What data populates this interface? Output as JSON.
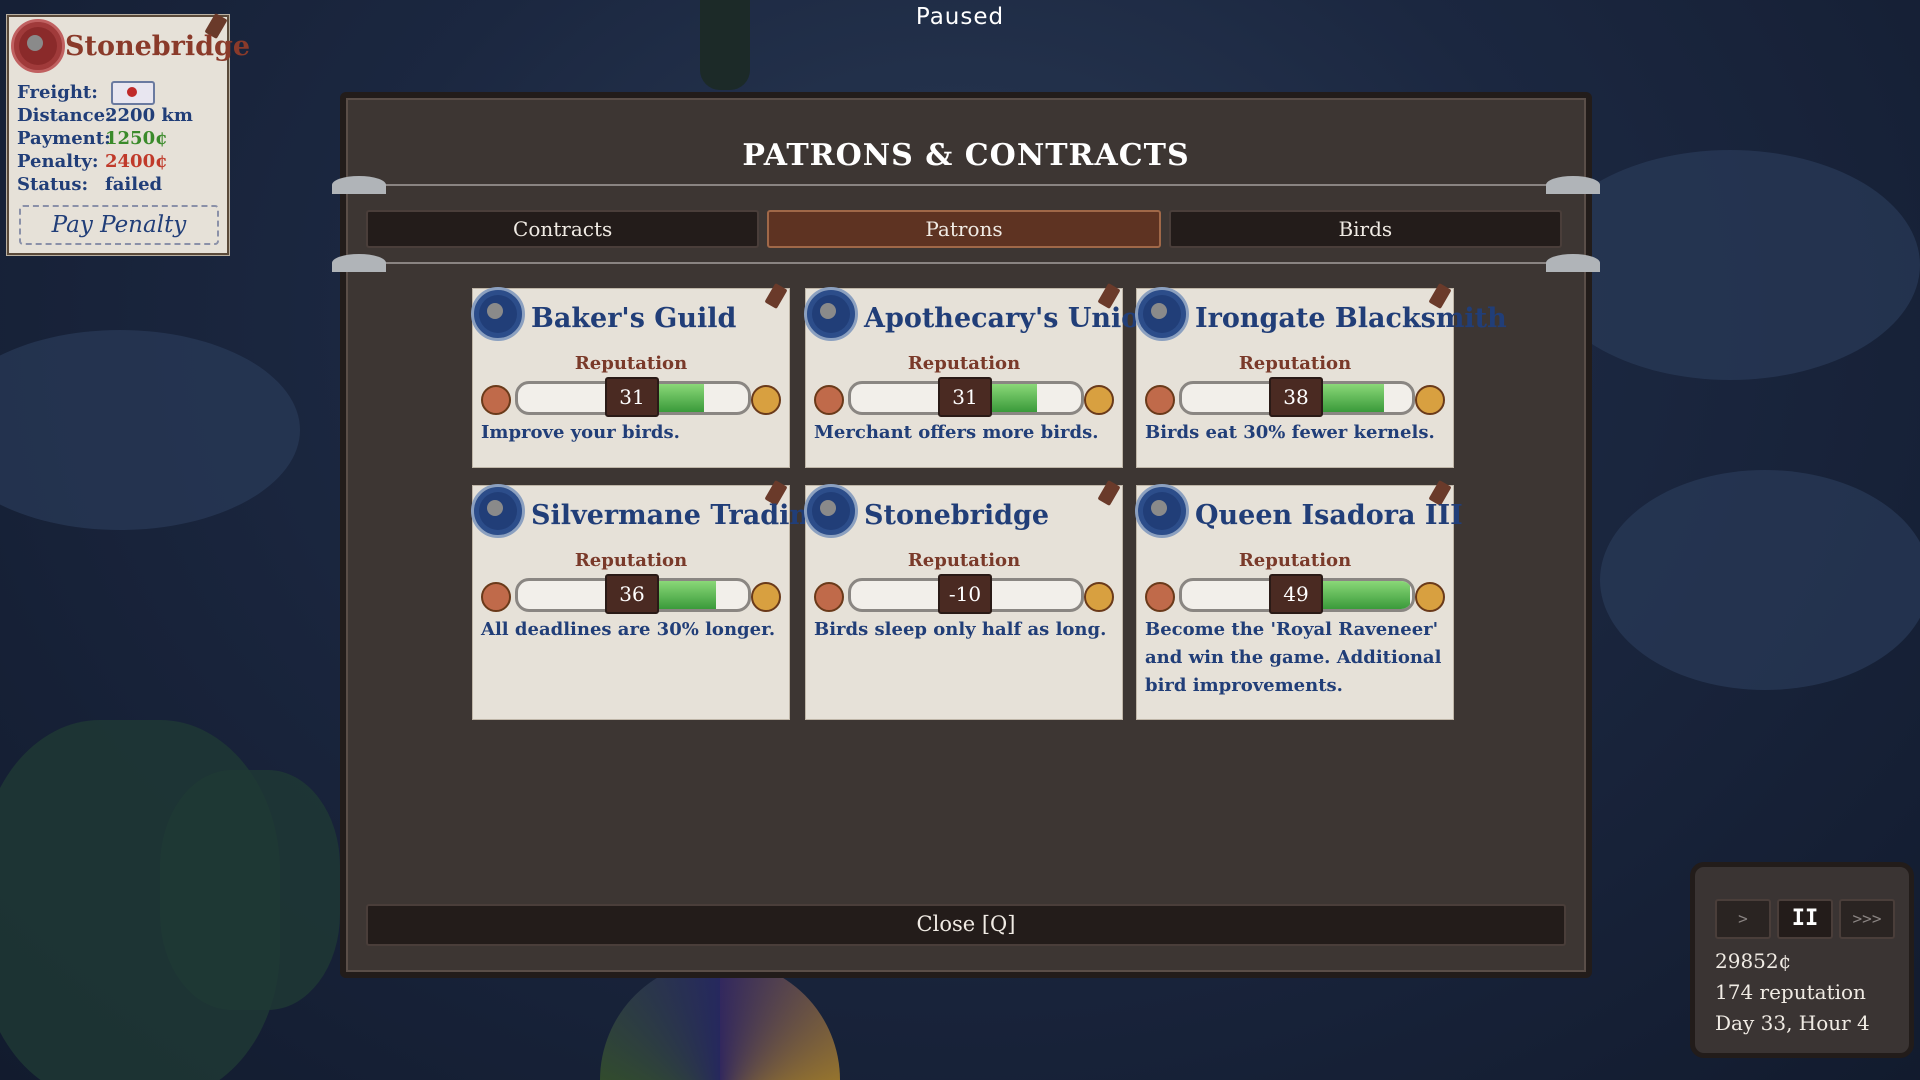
{
  "status": "Paused",
  "contract": {
    "city": "Stonebridge",
    "freight_label": "Freight:",
    "freight_icon": "letter-icon",
    "distance_label": "Distance:",
    "distance": "2200 km",
    "payment_label": "Payment:",
    "payment": "1250¢",
    "penalty_label": "Penalty:",
    "penalty": "2400¢",
    "status_label": "Status:",
    "status": "failed",
    "pay_button": "Pay Penalty"
  },
  "panel": {
    "title": "PATRONS & CONTRACTS",
    "tabs": [
      {
        "label": "Contracts",
        "active": false
      },
      {
        "label": "Patrons",
        "active": true
      },
      {
        "label": "Birds",
        "active": false
      }
    ],
    "close_label": "Close [Q]"
  },
  "patrons": [
    {
      "name": "Baker's Guild",
      "reputation_label": "Reputation",
      "reputation": 31,
      "description": "Improve your birds."
    },
    {
      "name": "Apothecary's Union",
      "reputation_label": "Reputation",
      "reputation": 31,
      "description": "Merchant offers more birds."
    },
    {
      "name": "Irongate Blacksmith",
      "reputation_label": "Reputation",
      "reputation": 38,
      "description": "Birds eat 30% fewer kernels."
    },
    {
      "name": "Silvermane Trading",
      "reputation_label": "Reputation",
      "reputation": 36,
      "description": "All deadlines are 30% longer."
    },
    {
      "name": "Stonebridge",
      "reputation_label": "Reputation",
      "reputation": -10,
      "description": "Birds sleep only half as long."
    },
    {
      "name": "Queen Isadora III",
      "reputation_label": "Reputation",
      "reputation": 49,
      "description": "Become the 'Royal Raveneer' and win the game. Additional bird improvements."
    }
  ],
  "hud": {
    "speed_buttons": [
      ">",
      "II",
      ">>>"
    ],
    "money": "29852¢",
    "reputation": "174 reputation",
    "time": "Day 33, Hour 4"
  },
  "colors": {
    "panel_bg": "#3d3633",
    "card_bg": "#e6e1d8",
    "title_blue": "#213e78",
    "active_tab": "#5e3322",
    "positive": "#3a9a3a",
    "negative": "#b84a4a"
  }
}
